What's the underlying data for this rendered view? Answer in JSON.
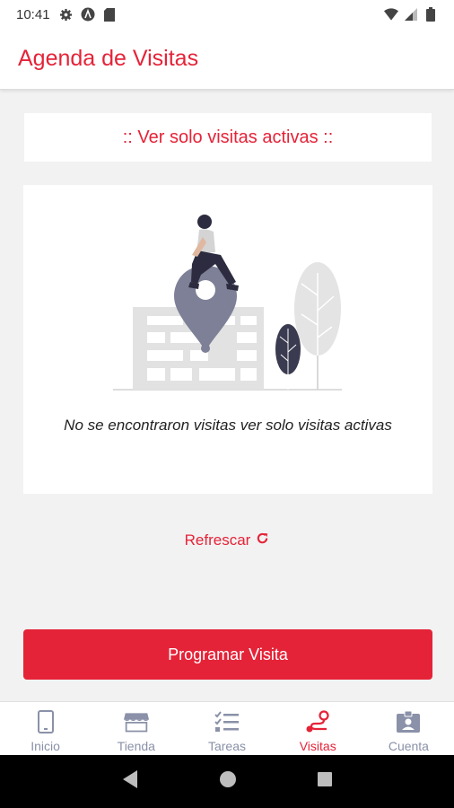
{
  "status_bar": {
    "time": "10:41",
    "left_icons": [
      "gear-icon",
      "app-a-icon",
      "sd-card-icon"
    ],
    "right_icons": [
      "wifi-icon",
      "signal-icon",
      "battery-icon"
    ]
  },
  "app_bar": {
    "title": "Agenda de Visitas"
  },
  "filter": {
    "label": ":: Ver solo visitas activas ::"
  },
  "empty_state": {
    "message": "No se encontraron visitas ver solo visitas activas",
    "illustration": "person-on-map-pin-illustration"
  },
  "refresh": {
    "label": "Refrescar",
    "icon": "refresh-icon"
  },
  "primary_action": {
    "label": "Programar Visita"
  },
  "bottom_nav": {
    "items": [
      {
        "label": "Inicio",
        "icon": "phone-icon",
        "active": false
      },
      {
        "label": "Tienda",
        "icon": "store-icon",
        "active": false
      },
      {
        "label": "Tareas",
        "icon": "checklist-icon",
        "active": false
      },
      {
        "label": "Visitas",
        "icon": "route-icon",
        "active": true
      },
      {
        "label": "Cuenta",
        "icon": "id-badge-icon",
        "active": false
      }
    ]
  },
  "colors": {
    "accent": "#e52338",
    "nav_inactive": "#8a91a8",
    "background": "#f2f2f2"
  }
}
